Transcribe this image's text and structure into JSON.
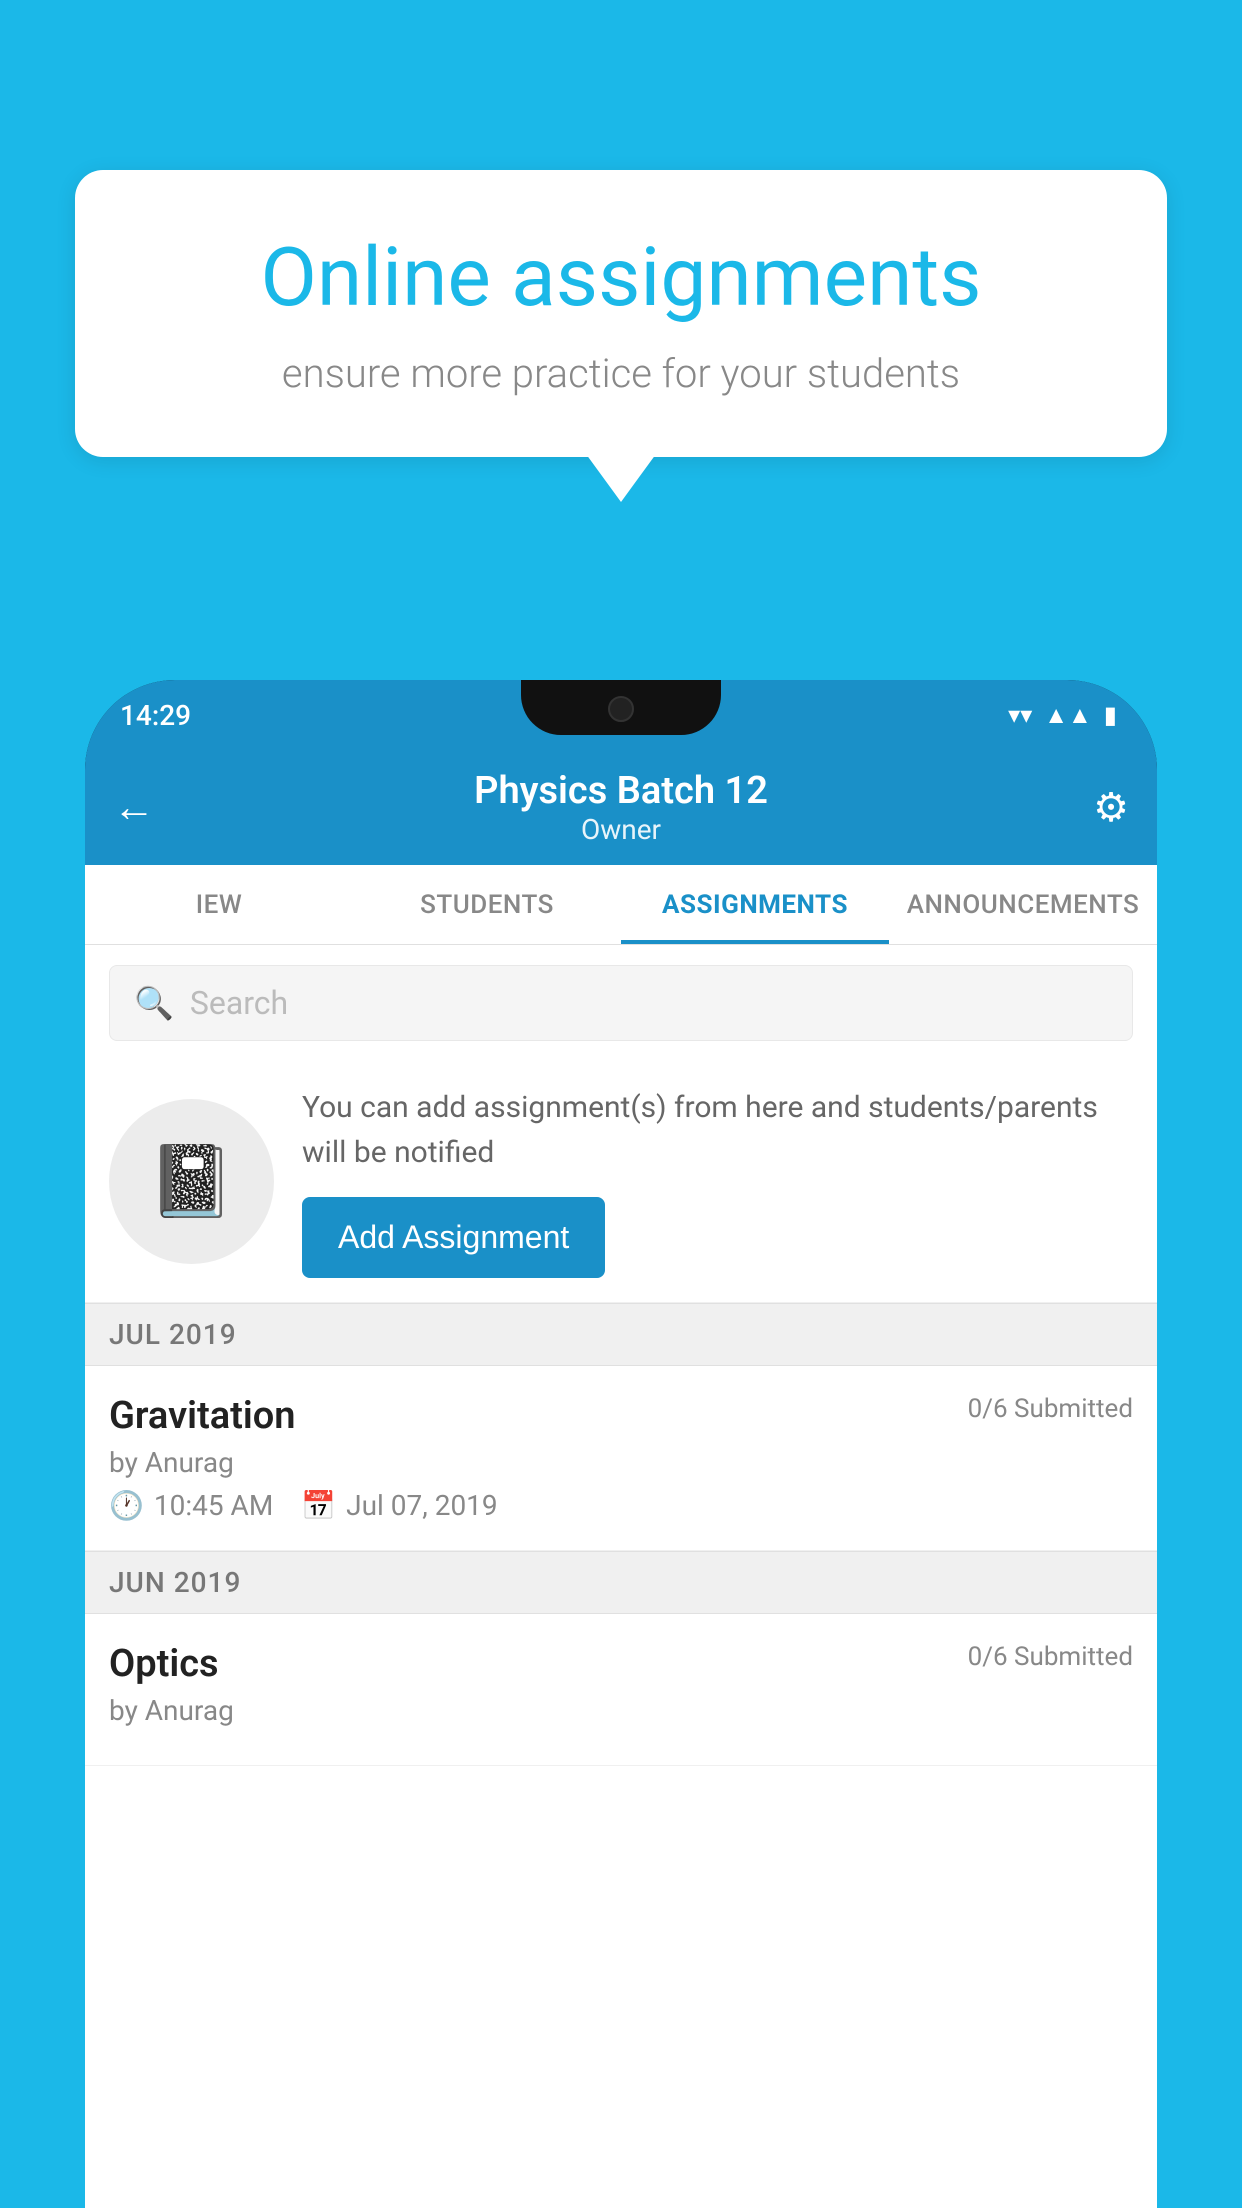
{
  "background_color": "#1BB8E8",
  "speech_bubble": {
    "title": "Online assignments",
    "subtitle": "ensure more practice for your students"
  },
  "status_bar": {
    "time": "14:29",
    "icons": [
      "wifi",
      "signal",
      "battery"
    ]
  },
  "header": {
    "title": "Physics Batch 12",
    "subtitle": "Owner",
    "back_label": "←",
    "settings_label": "⚙"
  },
  "tabs": [
    {
      "label": "IEW",
      "active": false
    },
    {
      "label": "STUDENTS",
      "active": false
    },
    {
      "label": "ASSIGNMENTS",
      "active": true
    },
    {
      "label": "ANNOUNCEMENTS",
      "active": false
    }
  ],
  "search": {
    "placeholder": "Search"
  },
  "info_card": {
    "text": "You can add assignment(s) from here and students/parents will be notified",
    "button_label": "Add Assignment"
  },
  "sections": [
    {
      "month": "JUL 2019",
      "assignments": [
        {
          "title": "Gravitation",
          "submitted": "0/6 Submitted",
          "by": "by Anurag",
          "time": "10:45 AM",
          "date": "Jul 07, 2019"
        }
      ]
    },
    {
      "month": "JUN 2019",
      "assignments": [
        {
          "title": "Optics",
          "submitted": "0/6 Submitted",
          "by": "by Anurag",
          "time": "",
          "date": ""
        }
      ]
    }
  ]
}
